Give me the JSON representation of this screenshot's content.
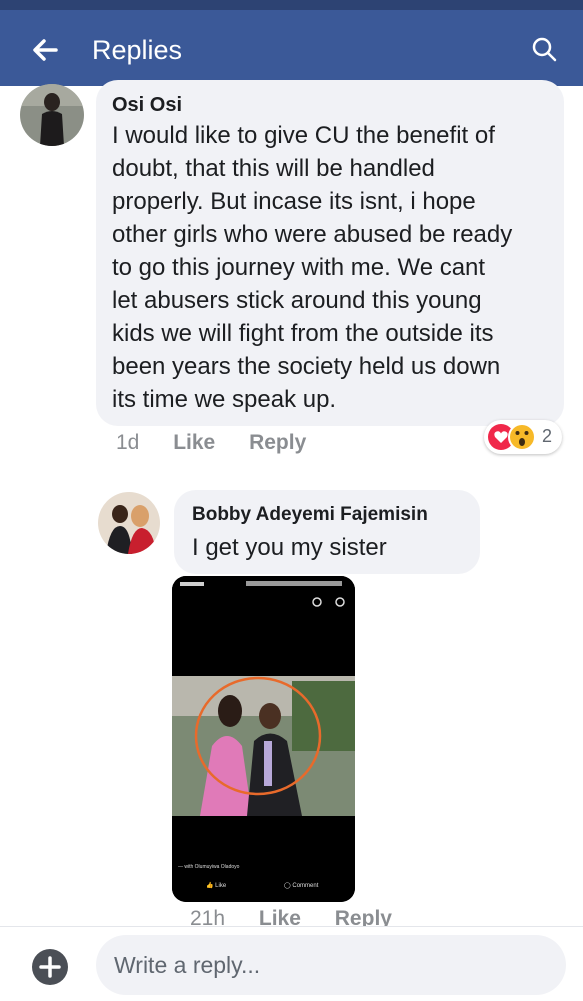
{
  "header": {
    "title": "Replies"
  },
  "comment1": {
    "author": "Osi Osi",
    "lines": [
      "I would like to give CU the benefit of",
      "doubt, that this will be handled",
      "properly. But incase its isnt,  i hope",
      "other girls who were abused be ready",
      "to go this journey with me. We cant",
      "let abusers stick around this young",
      "kids we will fight from the outside its",
      "been years the society held us down",
      "its time we speak up."
    ],
    "time": "1d",
    "like_label": "Like",
    "reply_label": "Reply",
    "reaction_count": "2",
    "reaction_icons": [
      "heart-icon",
      "wow-icon"
    ],
    "colors": {
      "heart": "#f0284a",
      "wow": "#f7b928"
    }
  },
  "comment2": {
    "author": "Bobby Adeyemi Fajemisin",
    "text": "I get you my sister",
    "time": "21h",
    "like_label": "Like",
    "reply_label": "Reply",
    "attachment": {
      "caption": "— with Olumuyiwa Oladoyo",
      "like_label": "Like",
      "comment_label": "Comment"
    }
  },
  "composer": {
    "placeholder": "Write a reply..."
  },
  "colors": {
    "header": "#3b5998",
    "bubble": "#f1f2f6",
    "meta": "#8a8d91"
  }
}
